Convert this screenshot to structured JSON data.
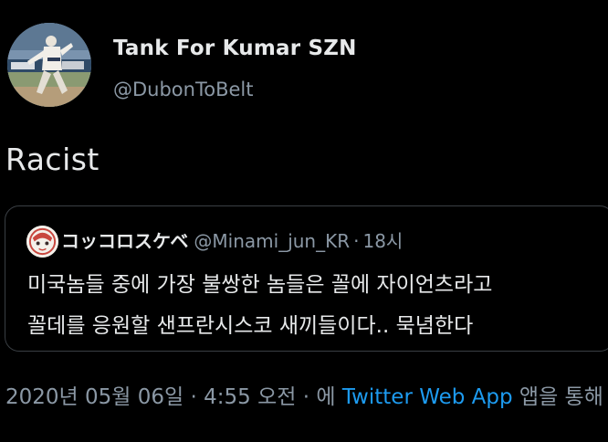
{
  "author": {
    "display_name": "Tank For Kumar SZN",
    "handle": "@DubonToBelt",
    "avatar_icon": "baseball-pitcher-photo"
  },
  "tweet": {
    "text": "Racist"
  },
  "quoted_tweet": {
    "display_name": "コッコロスケベ",
    "handle": "@Minami_jun_KR",
    "separator": "·",
    "time": "18시",
    "text_line_1": "미국놈들 중에 가장 불쌍한 놈들은 꼴에 자이언츠라고",
    "text_line_2": "꼴데를 응원할 샌프란시스코 새끼들이다.. 묵념한다",
    "avatar_icon": "anime-character-avatar"
  },
  "meta": {
    "date": "2020년 05월 06일",
    "separator_1": " · ",
    "time": "4:55 오전",
    "separator_2": " · ",
    "via_prefix": "에 ",
    "app": "Twitter Web App",
    "via_suffix": " 앱을 통해"
  },
  "colors": {
    "background": "#000000",
    "primary_text": "#e7e9ea",
    "secondary_text": "#8b98a5",
    "link": "#1d9bf0",
    "border": "#3a3f44"
  }
}
